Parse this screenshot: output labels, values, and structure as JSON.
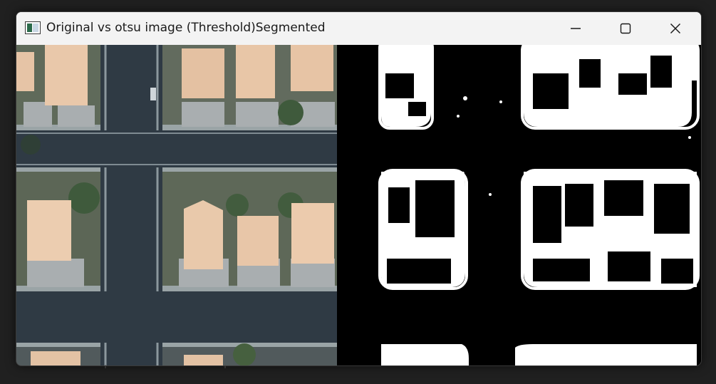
{
  "window": {
    "title": "Original vs otsu image (Threshold)Segmented",
    "app_icon": "image-viewer-icon",
    "controls": {
      "minimize": "minimize-icon",
      "maximize": "maximize-icon",
      "close": "close-icon"
    }
  },
  "images": {
    "left": "aerial-original-image",
    "right": "otsu-threshold-segmented-image"
  },
  "colors": {
    "titlebar_bg": "#f3f3f3",
    "title_text": "#1a1a1a",
    "road": "#2e3440",
    "roof": "#e8c7a8",
    "mask_fg": "#ffffff",
    "mask_bg": "#000000"
  }
}
